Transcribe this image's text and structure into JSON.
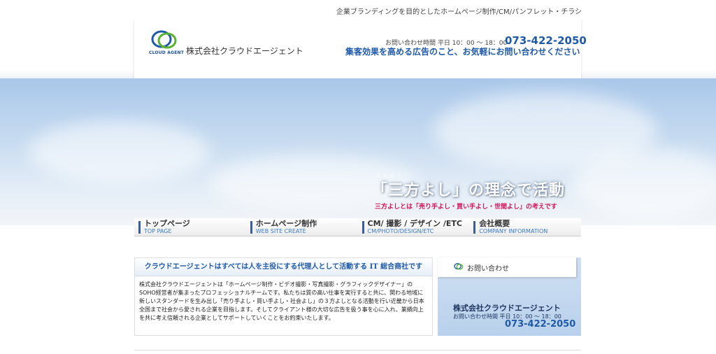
{
  "header": {
    "tagline": "企業ブランディングを目的としたホームページ制作/CM/パンフレット・チラシ",
    "logo_text": "CLOUD AGENT",
    "company_name": "株式会社クラウドエージェント",
    "contact_hours": "お問い合わせ時間 平日 10：00 〜 18：00",
    "phone": "073-422-2050",
    "slogan": "集客効果を高める広告のこと、お気軽にお問い合わせください"
  },
  "hero": {
    "ruby": "さんぽう",
    "title": "「三方よし」の理念で活動",
    "subtitle": "三方よしとは「売り手よし・買い手よし・世間よし」の考えです"
  },
  "nav": {
    "items": [
      {
        "jp": "トップページ",
        "en": "TOP PAGE"
      },
      {
        "jp": "ホームページ制作",
        "en": "WEB SITE CREATE"
      },
      {
        "jp": "CM/ 撮影 / デザイン /ETC",
        "en": "CM/PHOTO/DESIGN/ETC"
      },
      {
        "jp": "会社概要",
        "en": "COMPANY INFORMATION"
      }
    ]
  },
  "main": {
    "heading": "クラウドエージェントはすべては人を主役にする代理人として活動する IT 総合商社です",
    "body": "株式会社クラウドエージェントは「ホームページ制作・ビデオ撮影・写真撮影・グラフィックデザイナー」のSOHO経営者が集まったプロフェッショナルチームです。私たちは質の高い仕事を実行すると共に、関わる地域に新しいスタンダードを生み出し「売り手よし・買い手よし・社会よし」の３方よしとなる活動を行い近畿から日本全国まで社会から愛される企業を目指します。そしてクライアント様の大切な広告を扱う事を心に入れ、業績向上を共に考え信頼される企業としてサポートしていくことをお約束いたします。"
  },
  "sidebar": {
    "title": "お問い合わせ",
    "company": "株式会社クラウドエージェント",
    "hours": "お問い合わせ時間 平日 10：00 〜 18：00",
    "phone": "073-422-2050"
  },
  "colors": {
    "brand_blue": "#1f5aa8",
    "accent_pink": "#d4145a",
    "logo_green": "#4caf50"
  }
}
